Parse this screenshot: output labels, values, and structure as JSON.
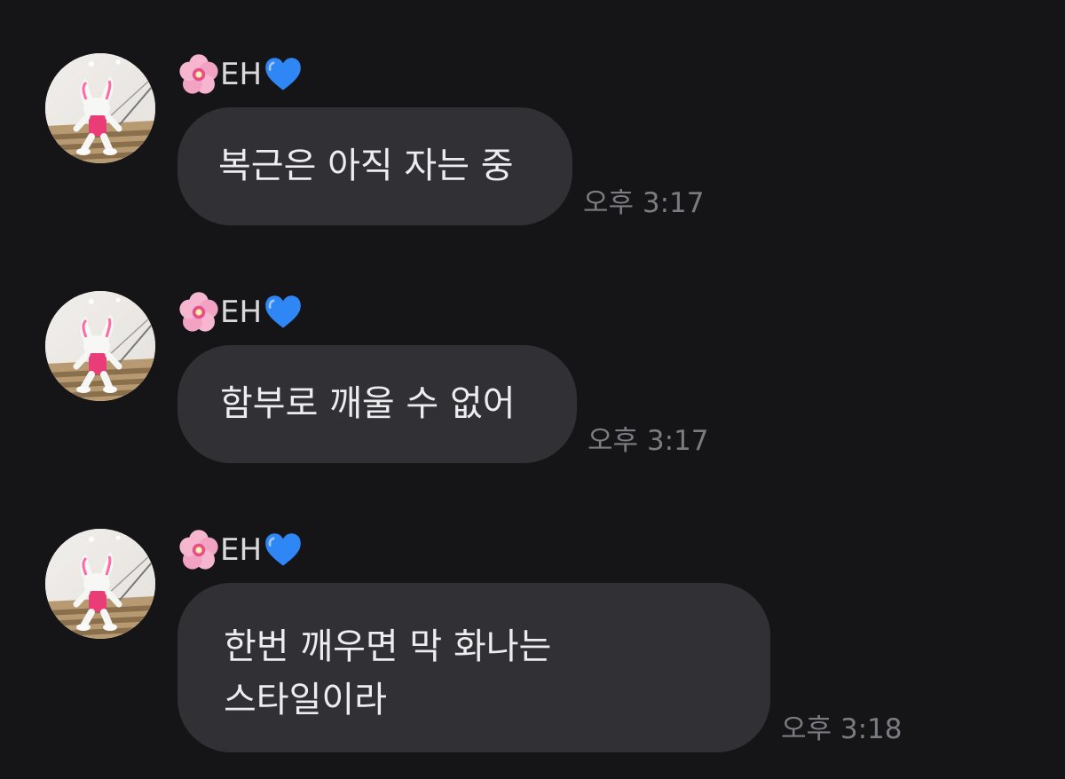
{
  "messages": [
    {
      "sender": "🌸EH💙",
      "sender_name": "EH",
      "text": "복근은 아직 자는 중",
      "time": "오후 3:17",
      "avatar": "rabbit-costume-on-stairs-avatar"
    },
    {
      "sender": "🌸EH💙",
      "sender_name": "EH",
      "text": "함부로 깨울 수 없어",
      "time": "오후 3:17",
      "avatar": "rabbit-costume-on-stairs-avatar"
    },
    {
      "sender": "🌸EH💙",
      "sender_name": "EH",
      "text_line1": "한번 깨우면 막 화나는",
      "text_line2": "스타일이라",
      "time": "오후 3:18",
      "avatar": "rabbit-costume-on-stairs-avatar"
    }
  ],
  "colors": {
    "background": "#151518",
    "bubble": "#313135",
    "message_text": "#ededf0",
    "timestamp": "#7b7b82",
    "flower_pink": "#f2a2c2",
    "heart_blue": "#2f86f5"
  },
  "icons": {
    "prefix": "cherry-blossom-icon",
    "suffix": "blue-heart-icon"
  }
}
